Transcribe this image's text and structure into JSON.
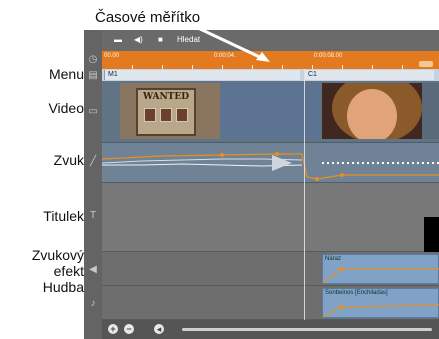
{
  "annotations": {
    "timescale": "Časové měřítko",
    "menu": "Menu",
    "video": "Video",
    "zvuk": "Zvuk",
    "titulek": "Titulek",
    "zvukovy": "Zvukový",
    "efekt": "efekt",
    "hudba": "Hudba"
  },
  "toolbar": {
    "search_label": "Hledat"
  },
  "ruler": {
    "labels": [
      "00.00",
      "0:00:04.",
      "0:00:08.00"
    ]
  },
  "menu_track": {
    "clips": [
      "M1",
      "C1"
    ]
  },
  "video_track": {
    "wanted_text": "WANTED"
  },
  "sfx_track": {
    "clip_label": "Náraz"
  },
  "music_track": {
    "clip_label": "Sonbeinos [Enchiladas]"
  },
  "icons": {
    "clock": "clock-icon",
    "menu": "menu-icon",
    "camera": "camera-icon",
    "speaker": "speaker-icon",
    "title": "title-icon",
    "note": "music-note-icon"
  }
}
